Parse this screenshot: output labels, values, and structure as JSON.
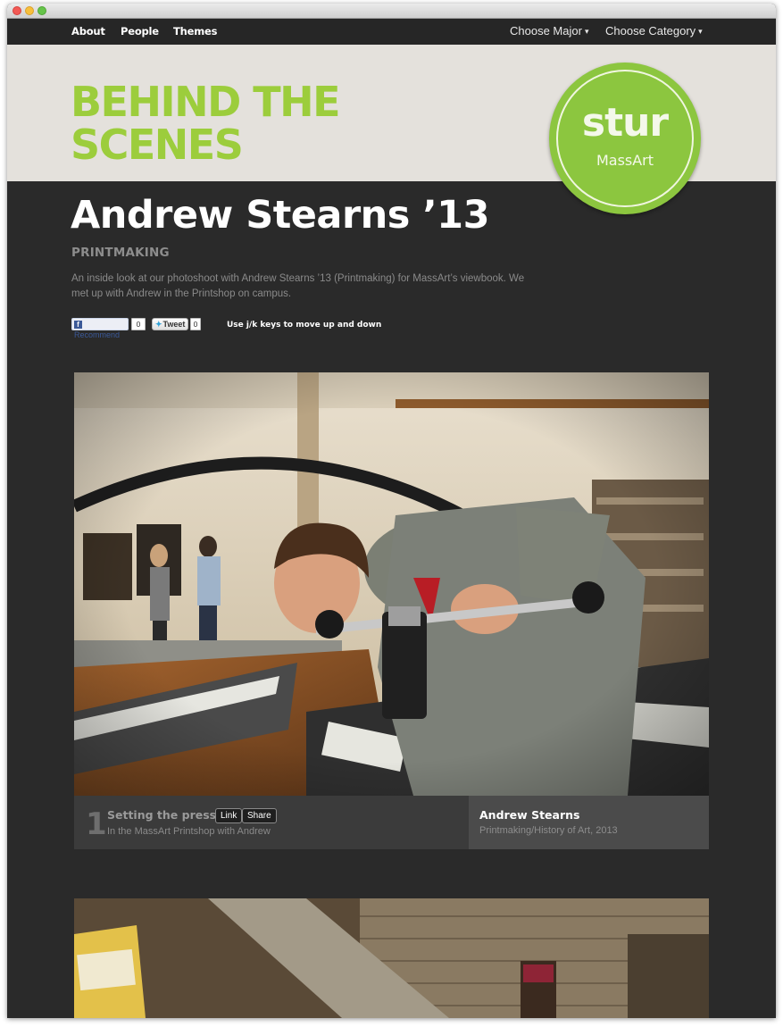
{
  "nav": {
    "links": [
      "About",
      "People",
      "Themes"
    ],
    "choose_major": "Choose Major",
    "choose_category": "Choose Category",
    "caret": "▾"
  },
  "banner": {
    "title_line1": "BEHIND THE",
    "title_line2": "SCENES",
    "logo_word": "stur",
    "logo_sub": "MassArt"
  },
  "article": {
    "title": "Andrew Stearns ’13",
    "category": "PRINTMAKING",
    "intro": "An inside look at our photoshoot with Andrew Stearns ’13 (Printmaking) for MassArt’s viewbook. We met up with Andrew in the Printshop on campus."
  },
  "social": {
    "recommend_label": "Recommend",
    "recommend_count": "0",
    "tweet_label": "Tweet",
    "tweet_count": "0",
    "keys_hint": "Use j/k keys to move up and down"
  },
  "slides": [
    {
      "number": "1",
      "title": "Setting the press",
      "link_label": "Link",
      "share_label": "Share",
      "subtitle": "In the MassArt Printshop with Andrew",
      "person_name": "Andrew Stearns",
      "person_program": "Printmaking/History of Art, 2013"
    }
  ],
  "colors": {
    "accent_green": "#9ccd3c",
    "logo_green": "#8cc63f",
    "page_dark": "#2a2a2a"
  }
}
